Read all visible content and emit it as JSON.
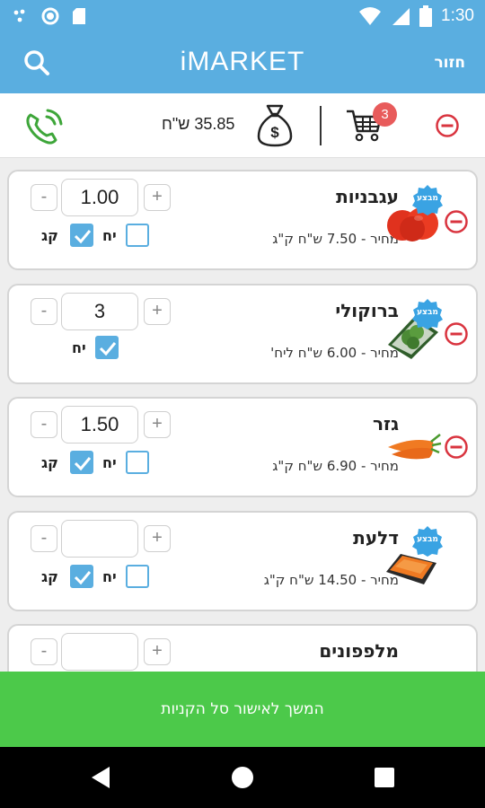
{
  "status_bar": {
    "time": "1:30",
    "icons": [
      "notification-dots-icon",
      "circle-icon",
      "sd-card-icon",
      "wifi-icon",
      "signal-icon",
      "battery-icon"
    ]
  },
  "app_bar": {
    "title": "iMARKET",
    "back_label": "חזור",
    "search_icon": "search-icon"
  },
  "summary": {
    "total": "35.85 ש\"ח",
    "cart_count": "3",
    "icons": [
      "money-bag-icon",
      "cart-icon",
      "phone-icon",
      "remove-circle-icon"
    ]
  },
  "products": [
    {
      "name": "עגבניות",
      "price": "מחיר - 7.50 ש\"ח ק\"ג",
      "quantity": "1.00",
      "unit_label": "יח",
      "kg_label": "קג",
      "sale_label": "מבצע",
      "has_kg_option": true,
      "unit_checked": false,
      "kg_checked": true,
      "on_sale": true,
      "removable": true,
      "image_icon": "tomato-icon"
    },
    {
      "name": "ברוקולי",
      "price": "מחיר - 6.00 ש\"ח ליח'",
      "quantity": "3",
      "unit_label": "יח",
      "sale_label": "מבצע",
      "has_kg_option": false,
      "unit_checked": true,
      "on_sale": true,
      "removable": true,
      "image_icon": "broccoli-icon"
    },
    {
      "name": "גזר",
      "price": "מחיר - 6.90 ש\"ח ק\"ג",
      "quantity": "1.50",
      "unit_label": "יח",
      "kg_label": "קג",
      "has_kg_option": true,
      "unit_checked": false,
      "kg_checked": true,
      "on_sale": false,
      "removable": true,
      "image_icon": "carrot-icon"
    },
    {
      "name": "דלעת",
      "price": "מחיר - 14.50 ש\"ח ק\"ג",
      "quantity": "",
      "unit_label": "יח",
      "kg_label": "קג",
      "sale_label": "מבצע",
      "has_kg_option": true,
      "unit_checked": false,
      "kg_checked": true,
      "on_sale": true,
      "removable": false,
      "image_icon": "pumpkin-icon"
    },
    {
      "name": "מלפפונים",
      "quantity": "",
      "image_icon": "cucumber-icon"
    }
  ],
  "stepper": {
    "minus": "-",
    "plus": "+"
  },
  "continue_button": {
    "label": "המשך לאישור סל הקניות"
  },
  "nav_bar": {
    "icons": [
      "back-nav-icon",
      "home-nav-icon",
      "recents-nav-icon"
    ]
  },
  "colors": {
    "app_bar": "#5aaee0",
    "checkbox": "#5aaee0",
    "remove": "#d9343f",
    "badge": "#e85b5b",
    "continue": "#4cc94a",
    "sale_badge": "#3aa3e3"
  }
}
